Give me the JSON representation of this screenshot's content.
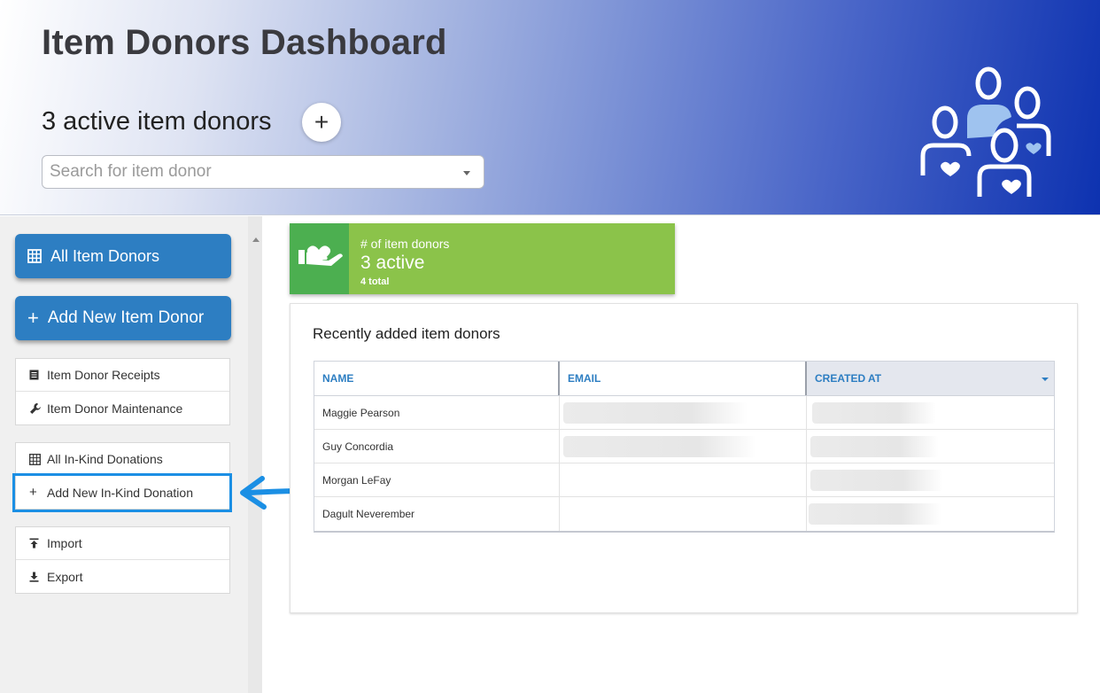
{
  "header": {
    "title": "Item Donors Dashboard",
    "active_count": "3 active item donors",
    "add_symbol": "+",
    "search_placeholder": "Search for item donor"
  },
  "sidebar": {
    "all_item_donors": "All Item Donors",
    "add_new_item_donor": "Add New Item Donor",
    "group1": [
      {
        "label": "Item Donor Receipts",
        "icon": "receipt-icon"
      },
      {
        "label": "Item Donor Maintenance",
        "icon": "wrench-icon"
      }
    ],
    "group2": [
      {
        "label": "All In-Kind Donations",
        "icon": "grid-icon"
      },
      {
        "label": "Add New In-Kind Donation",
        "icon": "plus-icon"
      }
    ],
    "group3": [
      {
        "label": "Import",
        "icon": "upload-icon"
      },
      {
        "label": "Export",
        "icon": "download-icon"
      }
    ]
  },
  "stat_card": {
    "label": "# of item donors",
    "value": "3 active",
    "total": "4 total",
    "color": "#8bc34a",
    "icon_bg": "#4caf50"
  },
  "recent": {
    "title": "Recently added item donors",
    "columns": [
      "NAME",
      "EMAIL",
      "CREATED AT"
    ],
    "rows": [
      {
        "name": "Maggie Pearson"
      },
      {
        "name": "Guy Concordia"
      },
      {
        "name": "Morgan LeFay"
      },
      {
        "name": "Dagult Neverember"
      }
    ]
  },
  "colors": {
    "accent": "#2d7ec2",
    "highlight": "#1b8fe4"
  }
}
